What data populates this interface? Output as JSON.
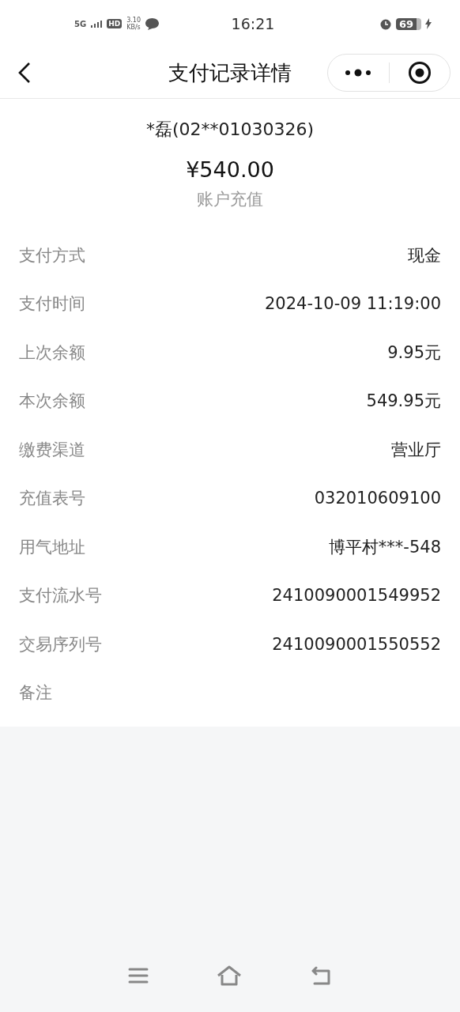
{
  "status_bar": {
    "network": "5G",
    "hd": "HD",
    "speed": "3.10",
    "speed_unit": "KB/s",
    "time": "16:21",
    "battery": "69"
  },
  "header": {
    "title": "支付记录详情"
  },
  "summary": {
    "name": "*磊(02**01030326)",
    "amount": "¥540.00",
    "type": "账户充值"
  },
  "details": [
    {
      "label": "支付方式",
      "value": "现金"
    },
    {
      "label": "支付时间",
      "value": "2024-10-09 11:19:00"
    },
    {
      "label": "上次余额",
      "value": "9.95元"
    },
    {
      "label": "本次余额",
      "value": "549.95元"
    },
    {
      "label": "缴费渠道",
      "value": "营业厅"
    },
    {
      "label": "充值表号",
      "value": "032010609100"
    },
    {
      "label": "用气地址",
      "value": "博平村***-548"
    },
    {
      "label": "支付流水号",
      "value": "2410090001549952"
    },
    {
      "label": "交易序列号",
      "value": "2410090001550552"
    },
    {
      "label": "备注"
    }
  ]
}
